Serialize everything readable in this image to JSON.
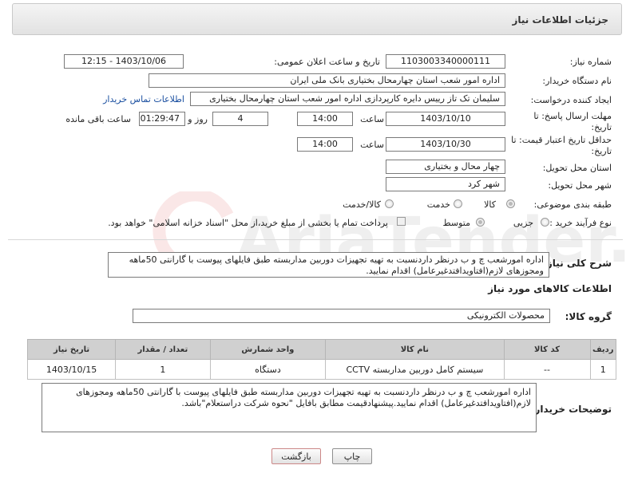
{
  "header": {
    "title": "جزئیات اطلاعات نیاز"
  },
  "fields": {
    "need_number_label": "شماره نیاز:",
    "need_number": "1103003340000111",
    "announce_label": "تاریخ و ساعت اعلان عمومی:",
    "announce_value": "1403/10/06 - 12:15",
    "buyer_org_label": "نام دستگاه خریدار:",
    "buyer_org": "اداره امور شعب استان چهارمحال بختیاری بانک ملی ایران",
    "creator_label": "ایجاد کننده درخواست:",
    "creator": "سلیمان تک تاز رییس دایره کارپردازی  اداره امور شعب استان چهارمحال بختیاری",
    "contact_link": "اطلاعات تماس خریدار",
    "deadline_label_1": "مهلت ارسال پاسخ: تا",
    "deadline_label_2": "تاریخ:",
    "deadline_date": "1403/10/10",
    "time_label": "ساعت",
    "deadline_time": "14:00",
    "days_value": "4",
    "days_label": "روز و",
    "remaining_value": "01:29:47",
    "remaining_label": "ساعت باقی مانده",
    "validity_label_1": "حداقل تاریخ اعتبار قیمت: تا",
    "validity_label_2": "تاریخ:",
    "validity_date": "1403/10/30",
    "validity_time": "14:00",
    "province_label": "استان محل تحویل:",
    "province": "چهار محال و بختیاری",
    "city_label": "شهر محل تحویل:",
    "city": "شهر کرد",
    "category_label": "طبقه بندی موضوعی:",
    "category_options": [
      "کالا",
      "خدمت",
      "کالا/خدمت"
    ],
    "process_label": "نوع فرآیند خرید :",
    "process_options": [
      "جزیی",
      "متوسط"
    ],
    "payment_note": "پرداخت تمام یا بخشی از مبلغ خرید،از محل \"اسناد خزانه اسلامی\" خواهد بود."
  },
  "general_description": {
    "label": "شرح کلی نیاز:",
    "text": "اداره امورشعب چ و ب درنظر داردنسبت به تهیه تجهیزات دوربین مداربسته طبق فایلهای پیوست با گارانتی 50ماهه ومجوزهای لازم(افتاویدافتدغیرعامل) اقدام نمایید."
  },
  "goods_section": {
    "title": "اطلاعات کالاهای مورد نیاز",
    "group_label": "گروه کالا:",
    "group_value": "محصولات الکترونیکی"
  },
  "table": {
    "headers": [
      "ردیف",
      "کد کالا",
      "نام کالا",
      "واحد شمارش",
      "تعداد / مقدار",
      "تاریخ نیاز"
    ],
    "rows": [
      [
        "1",
        "--",
        "سیستم کامل دوربین مداربسته CCTV",
        "دستگاه",
        "1",
        "1403/10/15"
      ]
    ]
  },
  "buyer_notes": {
    "label": "توضیحات خریدار:",
    "text": "اداره امورشعب چ و ب درنظر داردنسبت به تهیه تجهیزات دوربین مداربسته طبق فایلهای پیوست با گارانتی 50ماهه ومجوزهای لازم(افتاویدافتدغیرعامل) اقدام نمایید.پیشنهادقیمت مطابق بافایل \"نحوه شرکت دراستعلام\"باشد."
  },
  "buttons": {
    "print": "چاپ",
    "back": "بازگشت"
  },
  "watermark": "AriaTender.neT",
  "colors": {
    "accent_link": "#1a4fa0",
    "back_button_border": "#c88",
    "table_header": "#d0d0d0"
  }
}
